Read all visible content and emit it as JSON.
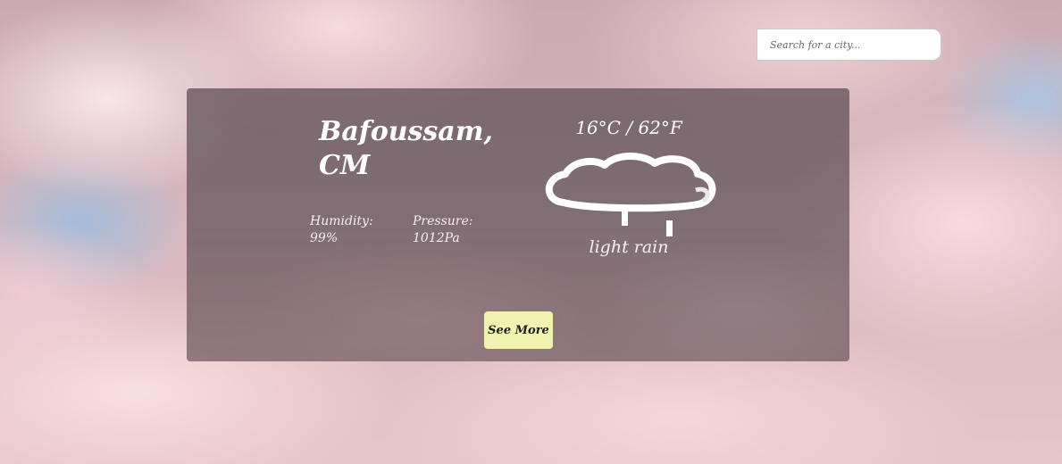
{
  "search": {
    "placeholder": "Search for a city..."
  },
  "weather": {
    "city": "Bafoussam, CM",
    "temperature": "16°C / 62°F",
    "icon": "rain-cloud-icon",
    "description": "light rain",
    "humidity": "Humidity: 99%",
    "pressure": "Pressure: 1012Pa"
  },
  "actions": {
    "see_more_label": "See More"
  },
  "colors": {
    "button_bg": "#f1f1b0",
    "card_overlay": "#5f5258",
    "text": "#ffffff"
  }
}
